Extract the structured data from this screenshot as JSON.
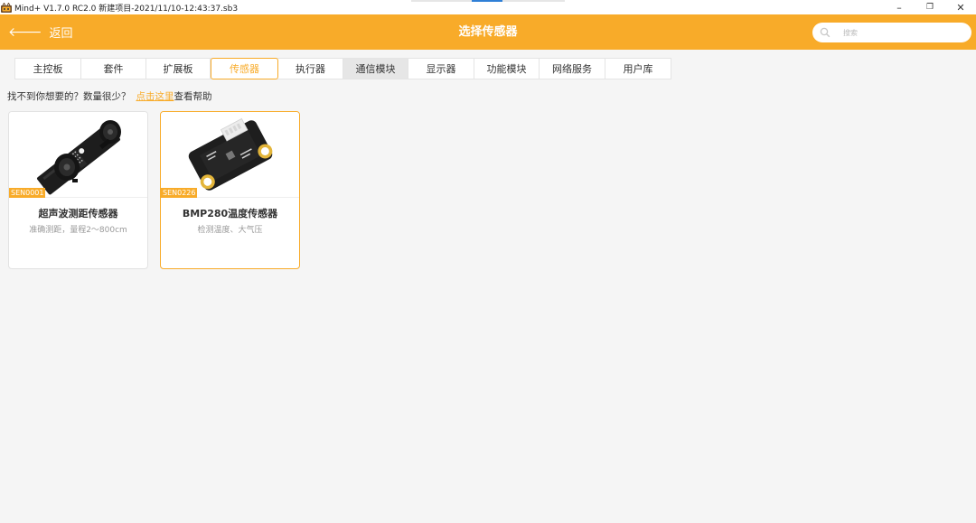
{
  "window": {
    "title": "Mind+ V1.7.0 RC2.0  新建项目-2021/11/10-12:43:37.sb3",
    "controls": {
      "minimize": "–",
      "restore": "❐",
      "close": "✕"
    }
  },
  "header": {
    "back_label": "返回",
    "title": "选择传感器",
    "search_placeholder": "搜索",
    "search_value": "",
    "bg_color": "#f8ab29"
  },
  "tabs": [
    {
      "label": "主控板",
      "width": 73
    },
    {
      "label": "套件",
      "width": 72
    },
    {
      "label": "扩展板",
      "width": 71
    },
    {
      "label": "传感器",
      "width": 75,
      "active": true
    },
    {
      "label": "执行器",
      "width": 72
    },
    {
      "label": "通信模块",
      "width": 72,
      "hovered": true
    },
    {
      "label": "显示器",
      "width": 73
    },
    {
      "label": "功能模块",
      "width": 72
    },
    {
      "label": "网络服务",
      "width": 73
    },
    {
      "label": "用户库",
      "width": 72
    }
  ],
  "help": {
    "text": "找不到你想要的？数量很少？",
    "link": "点击这里",
    "suffix": "查看帮助"
  },
  "cards": [
    {
      "code": "SEN0001",
      "title": "超声波测距传感器",
      "desc": "准确测距，量程2～800cm",
      "selected": false
    },
    {
      "code": "SEN0226",
      "title": "BMP280温度传感器",
      "desc": "检测温度、大气压",
      "selected": true
    }
  ],
  "colors": {
    "accent": "#f8ab29",
    "background": "#f5f5f5"
  }
}
